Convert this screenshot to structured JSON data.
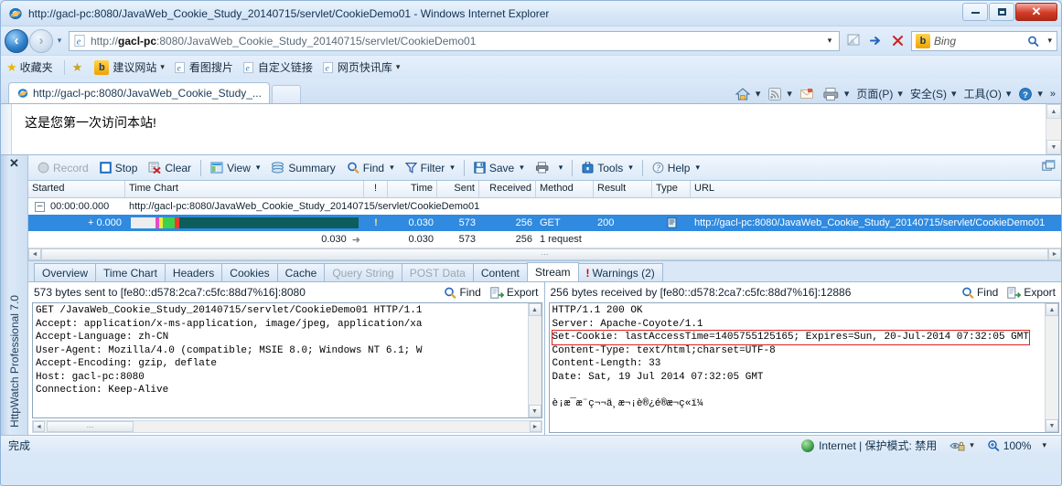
{
  "window": {
    "title": "http://gacl-pc:8080/JavaWeb_Cookie_Study_20140715/servlet/CookieDemo01 - Windows Internet Explorer",
    "minimize_label": "Minimize",
    "maximize_label": "Maximize",
    "close_label": "✕"
  },
  "address_bar": {
    "back_glyph": "‹",
    "forward_glyph": "›",
    "recent_caret": "▾",
    "url_prefix": "http://",
    "url_host": "gacl-pc",
    "url_rest": ":8080/JavaWeb_Cookie_Study_20140715/servlet/CookieDemo01",
    "url_full": "http://gacl-pc:8080/JavaWeb_Cookie_Study_20140715/servlet/CookieDemo01",
    "dropdown_caret": "▾",
    "compat_title": "Compatibility View",
    "go_glyph": "➜",
    "stop_glyph": "✕",
    "search_engine": "Bing",
    "search_placeholder": "Bing",
    "search_caret": "▾"
  },
  "favorites_bar": {
    "favorites_label": "收藏夹",
    "items": [
      {
        "label": "建议网站",
        "caret": "▾"
      },
      {
        "label": "看图搜片",
        "caret": ""
      },
      {
        "label": "自定义链接",
        "caret": ""
      },
      {
        "label": "网页快讯库",
        "caret": "▾"
      }
    ]
  },
  "tab_bar": {
    "tabs": [
      {
        "label": "http://gacl-pc:8080/JavaWeb_Cookie_Study_..."
      }
    ],
    "new_tab_label": "",
    "commands": [
      {
        "label": "",
        "name": "home-button",
        "caret": "▾"
      },
      {
        "label": "",
        "name": "feeds-button",
        "caret": "▾"
      },
      {
        "label": "",
        "name": "mail-button",
        "caret": ""
      },
      {
        "label": "",
        "name": "print-button",
        "caret": "▾"
      },
      {
        "label": "页面(P)",
        "name": "page-menu",
        "caret": "▾"
      },
      {
        "label": "安全(S)",
        "name": "safety-menu",
        "caret": "▾"
      },
      {
        "label": "工具(O)",
        "name": "tools-menu",
        "caret": "▾"
      },
      {
        "label": "",
        "name": "help-menu",
        "caret": "▾"
      }
    ],
    "overflow": "»"
  },
  "page": {
    "content": "这是您第一次访问本站!",
    "scroll_up": "▲",
    "scroll_down": "▼"
  },
  "httpwatch": {
    "product_label": "HttpWatch Professional 7.0",
    "close_glyph": "✕",
    "toolbar": [
      {
        "label": "Record",
        "icon": "record-icon",
        "caret": "",
        "disabled": true
      },
      {
        "label": "Stop",
        "icon": "stop-icon",
        "caret": "",
        "disabled": false
      },
      {
        "label": "Clear",
        "icon": "clear-icon",
        "caret": "",
        "disabled": false
      },
      {
        "label": "View",
        "icon": "view-icon",
        "caret": "▾",
        "disabled": false
      },
      {
        "label": "Summary",
        "icon": "summary-icon",
        "caret": "",
        "disabled": false
      },
      {
        "label": "Find",
        "icon": "find-icon",
        "caret": "▾",
        "disabled": false
      },
      {
        "label": "Filter",
        "icon": "filter-icon",
        "caret": "▾",
        "disabled": false
      },
      {
        "label": "Save",
        "icon": "save-icon",
        "caret": "▾",
        "disabled": false
      },
      {
        "label": "",
        "icon": "print-icon",
        "caret": "▾",
        "disabled": false
      },
      {
        "label": "Tools",
        "icon": "tools-icon",
        "caret": "▾",
        "disabled": false
      },
      {
        "label": "Help",
        "icon": "help-icon",
        "caret": "▾",
        "disabled": false
      }
    ],
    "grid": {
      "columns": [
        "Started",
        "Time Chart",
        "!",
        "Time",
        "Sent",
        "Received",
        "Method",
        "Result",
        "Type",
        "URL"
      ],
      "group_row": {
        "expander": "–",
        "started": "00:00:00.000",
        "url": "http://gacl-pc:8080/JavaWeb_Cookie_Study_20140715/servlet/CookieDemo01"
      },
      "selected_row": {
        "started": "+ 0.000",
        "warning": "!",
        "time": "0.030",
        "sent": "573",
        "received": "256",
        "method": "GET",
        "result": "200",
        "type": "page-icon",
        "url": "http://gacl-pc:8080/JavaWeb_Cookie_Study_20140715/servlet/CookieDemo01"
      },
      "total_row": {
        "chart_total": "0.030",
        "chart_arrow": "➜",
        "time": "0.030",
        "sent": "573",
        "received": "256",
        "method": "1 request"
      }
    },
    "tabs": [
      {
        "label": "Overview",
        "state": "normal"
      },
      {
        "label": "Time Chart",
        "state": "normal"
      },
      {
        "label": "Headers",
        "state": "normal"
      },
      {
        "label": "Cookies",
        "state": "normal"
      },
      {
        "label": "Cache",
        "state": "normal"
      },
      {
        "label": "Query String",
        "state": "disabled"
      },
      {
        "label": "POST Data",
        "state": "disabled"
      },
      {
        "label": "Content",
        "state": "normal"
      },
      {
        "label": "Stream",
        "state": "active"
      },
      {
        "label": "Warnings (2)",
        "state": "warning",
        "warn_glyph": "!"
      }
    ],
    "request_pane": {
      "summary": "573 bytes sent to [fe80::d578:2ca7:c5fc:88d7%16]:8080",
      "find_label": "Find",
      "export_label": "Export",
      "lines": [
        "GET /JavaWeb_Cookie_Study_20140715/servlet/CookieDemo01 HTTP/1.1",
        "Accept: application/x-ms-application, image/jpeg, application/xa",
        "Accept-Language: zh-CN",
        "User-Agent: Mozilla/4.0 (compatible; MSIE 8.0; Windows NT 6.1; W",
        "Accept-Encoding: gzip, deflate",
        "Host: gacl-pc:8080",
        "Connection: Keep-Alive"
      ],
      "scroll_up": "▲",
      "scroll_down": "▼",
      "scroll_left": "◄",
      "scroll_right": "►"
    },
    "response_pane": {
      "summary": "256 bytes received by [fe80::d578:2ca7:c5fc:88d7%16]:12886",
      "find_label": "Find",
      "export_label": "Export",
      "lines": [
        "HTTP/1.1 200 OK",
        "Server: Apache-Coyote/1.1",
        "Set-Cookie: lastAccessTime=1405755125165; Expires=Sun, 20-Jul-2014 07:32:05 GMT",
        "Content-Type: text/html;charset=UTF-8",
        "Content-Length: 33",
        "Date: Sat, 19 Jul 2014 07:32:05 GMT",
        "",
        "è¡æ¯æ¨ç¬¬ä¸æ¬¡è®¿é®æ¬ç«ï¼"
      ],
      "highlight_line_index": 2,
      "scroll_up": "▲",
      "scroll_down": "▼"
    }
  },
  "status_bar": {
    "status_text": "完成",
    "zone_text": "Internet | 保护模式: 禁用",
    "zone_caret": "▾",
    "zoom_level": "100%",
    "zoom_caret": "▾"
  },
  "colors": {
    "accent": "#2f8ae0",
    "close_red": "#d23b27",
    "warning_red": "#cc0000",
    "timechart_dark": "#0d5d5c"
  }
}
